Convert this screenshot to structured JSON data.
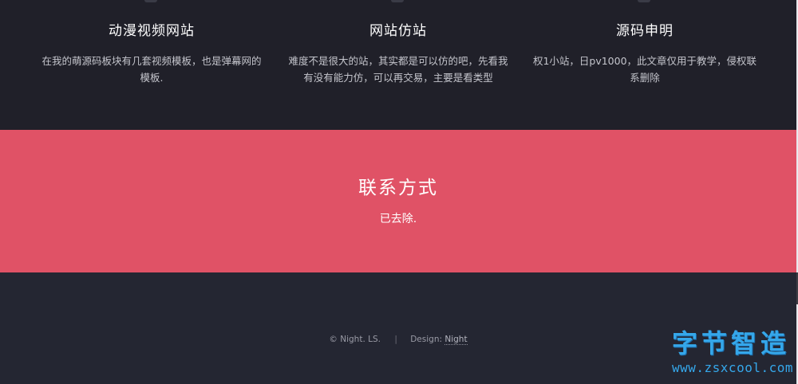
{
  "features": [
    {
      "title": "动漫视频网站",
      "text": "在我的萌源码板块有几套视频模板，也是弹幕网的模板."
    },
    {
      "title": "网站仿站",
      "text": "难度不是很大的站，其实都是可以仿的吧，先看我有没有能力仿，可以再交易，主要是看类型"
    },
    {
      "title": "源码申明",
      "text": "权1小站，日pv1000，此文章仅用于教学，侵权联系删除"
    }
  ],
  "contact": {
    "title": "联系方式",
    "text": "已去除."
  },
  "footer": {
    "copyright": "© Night. LS.",
    "separator": "|",
    "design_label": "Design:",
    "design_link": "Night"
  },
  "watermark": {
    "name": "字节智造",
    "url": "www.zsxcool.com"
  },
  "colors": {
    "features_bg": "#202029",
    "contact_bg": "#e05266",
    "footer_bg": "#242632",
    "watermark": "#35a7ea"
  }
}
